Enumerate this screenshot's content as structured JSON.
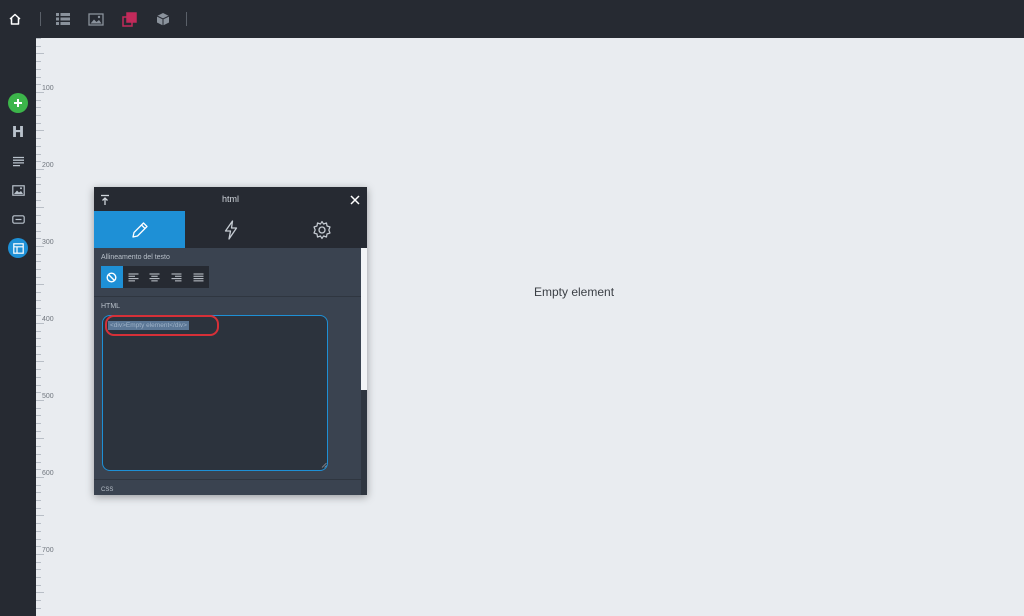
{
  "toolbar": {
    "home_icon": "home-icon",
    "items": [
      "list-icon",
      "image-gallery-icon",
      "layers-icon",
      "cube-icon"
    ]
  },
  "sidebar": {
    "items": [
      "add-icon",
      "heading-icon",
      "paragraph-icon",
      "image-icon",
      "button-icon",
      "layout-icon"
    ],
    "heading_glyph": "H"
  },
  "ruler": {
    "labels": [
      "100",
      "200",
      "300",
      "400",
      "500",
      "600",
      "700"
    ]
  },
  "canvas": {
    "element_text": "Empty element"
  },
  "panel": {
    "title": "html",
    "tabs": [
      "pencil-icon",
      "bolt-icon",
      "gear-icon"
    ],
    "active_tab": "pencil-icon",
    "alignment_label": "Allineamento del testo",
    "alignment_options": [
      "none",
      "left",
      "center",
      "right",
      "justify"
    ],
    "alignment_selected": "none",
    "html_label": "HTML",
    "html_value": "<div>Empty element</div>",
    "css_label": "CSS"
  },
  "colors": {
    "accent": "#1e90d6",
    "add_green": "#3cb54a",
    "highlight_red": "#d63038",
    "dark_bg": "#262a32",
    "panel_bg": "#3a4350",
    "canvas_bg": "#e9ecf0",
    "layers_icon_color": "#c22a5b"
  }
}
